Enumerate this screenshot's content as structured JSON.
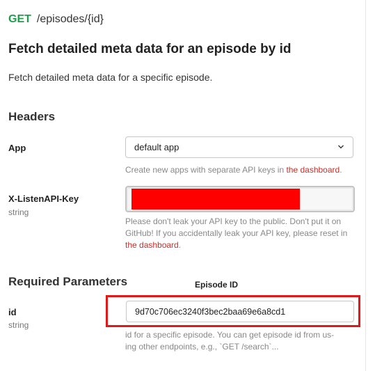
{
  "endpoint": {
    "method": "GET",
    "path": "/episodes/{id}"
  },
  "title": "Fetch detailed meta data for an episode by id",
  "description": "Fetch detailed meta data for a specific episode.",
  "headers": {
    "heading": "Headers",
    "app": {
      "label": "App",
      "selected": "default app",
      "help_text": "Create new apps with separate API keys in ",
      "help_link": "the dashboard",
      "help_suffix": "."
    },
    "api_key": {
      "label": "X-ListenAPI-Key",
      "type": "string",
      "help_text": "Please don't leak your API key to the public. Don't put it on GitHub! If you accidentally leak your API key, please reset in ",
      "help_link": "the dashboard",
      "help_suffix": ".",
      "redaction_color": "#ff0000"
    }
  },
  "required": {
    "heading": "Required Parameters",
    "annotation": "Episode ID",
    "annotation_color": "#e21717",
    "id": {
      "label": "id",
      "type": "string",
      "value": "9d70c706ec3240f3bec2baa69e6a8cd1",
      "help_line1": "id for a specific episode. You can get episode id from us-",
      "help_line2": "ing other endpoints, e.g., `GET /search`..."
    }
  },
  "colors": {
    "method_get": "#1e9e4a",
    "link": "#c0322b"
  }
}
